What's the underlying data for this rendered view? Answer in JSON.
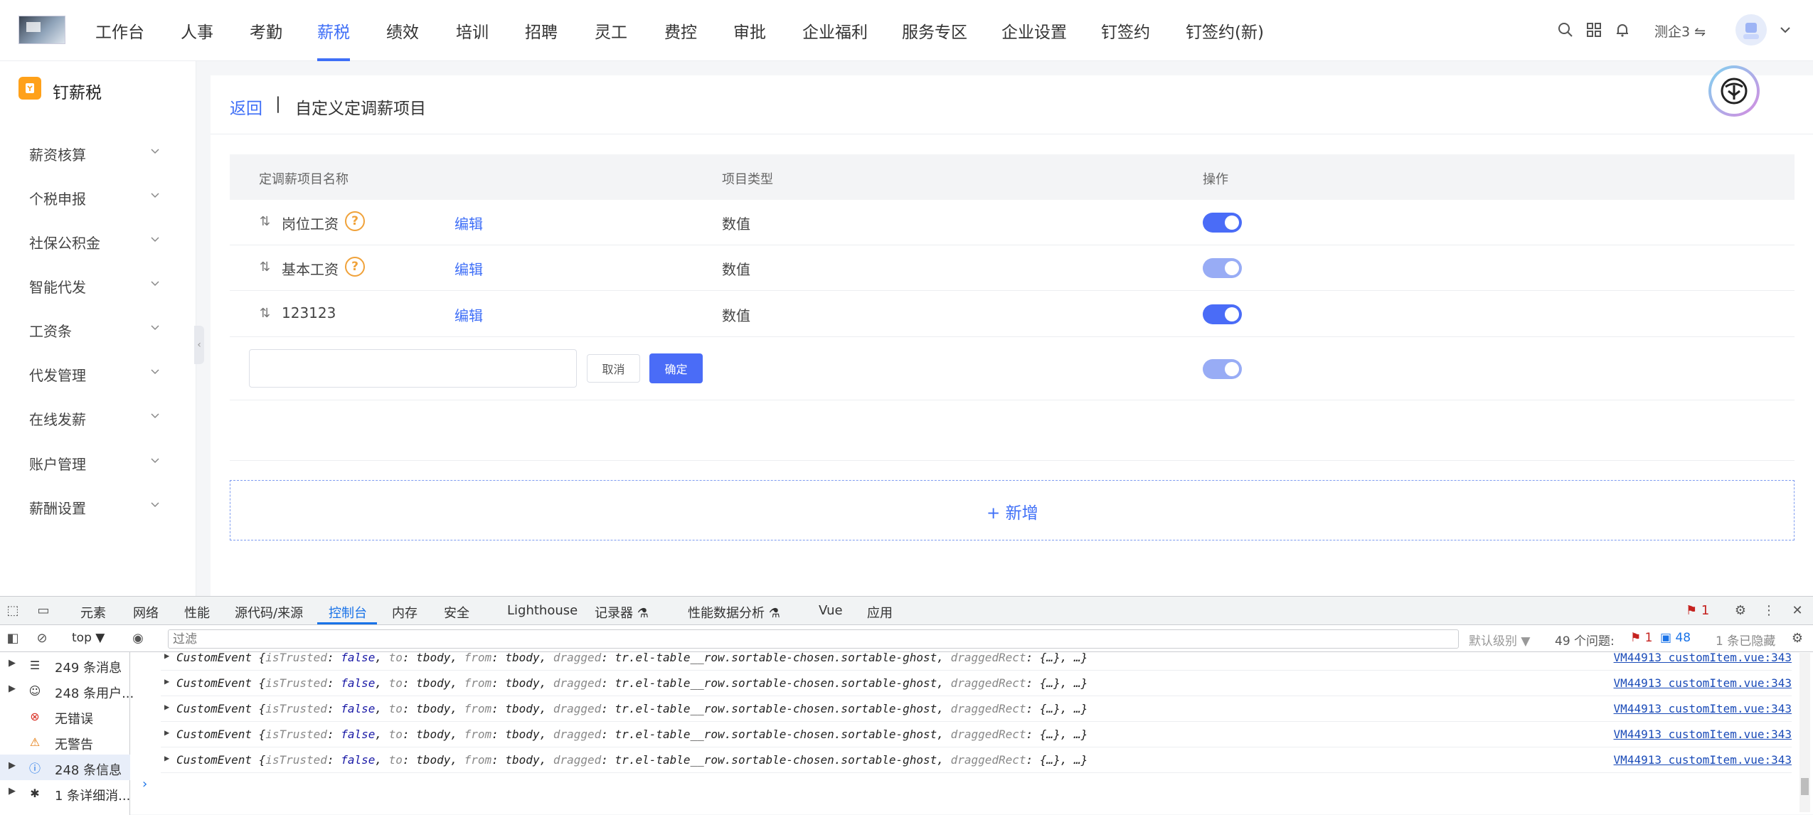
{
  "topnav": {
    "items": [
      "工作台",
      "人事",
      "考勤",
      "薪税",
      "绩效",
      "培训",
      "招聘",
      "灵工",
      "费控",
      "审批",
      "企业福利",
      "服务专区",
      "企业设置",
      "钉签约",
      "钉签约(新)"
    ],
    "active": "薪税",
    "user_name": "测企3",
    "switch_glyph": "⇋",
    "icons": [
      "search-icon",
      "apps-grid-icon",
      "bell-icon",
      "switch-org-icon",
      "user-avatar-icon",
      "chevron-down-icon"
    ]
  },
  "sidebar": {
    "title": "钉薪税",
    "items": [
      "薪资核算",
      "个税申报",
      "社保公积金",
      "智能代发",
      "工资条",
      "代发管理",
      "在线发薪",
      "账户管理",
      "薪酬设置"
    ],
    "collapse_glyph": "‹"
  },
  "page": {
    "back_label": "返回",
    "separator": "|",
    "title": "自定义定调薪项目"
  },
  "table": {
    "headers": [
      "定调薪项目名称",
      "项目类型",
      "操作"
    ],
    "rows": [
      {
        "name": "岗位工资",
        "has_help": true,
        "edit": "编辑",
        "type": "数值",
        "switch_on": true,
        "switch_disabled": false
      },
      {
        "name": "基本工资",
        "has_help": true,
        "edit": "编辑",
        "type": "数值",
        "switch_on": true,
        "switch_disabled": true
      },
      {
        "name": "123123",
        "has_help": false,
        "edit": "编辑",
        "type": "数值",
        "switch_on": true,
        "switch_disabled": false
      }
    ],
    "help_glyph": "?",
    "drag_glyph": "⇅",
    "new_row": {
      "input_value": "",
      "cancel": "取消",
      "confirm": "确定",
      "switch_on": true,
      "switch_disabled": true
    }
  },
  "add_button": {
    "label": "+ 新增"
  },
  "devtools": {
    "tabs": [
      "元素",
      "网络",
      "性能",
      "源代码/来源",
      "控制台",
      "内存",
      "安全",
      "Lighthouse",
      "记录器 ⚗",
      "性能数据分析 ⚗",
      "Vue",
      "应用"
    ],
    "active_tab": "控制台",
    "issue_badge": "1",
    "toolbar": {
      "context": "top ▼",
      "filter_placeholder": "过滤",
      "level": "默认级别 ▼",
      "issues_label": "49 个问题:",
      "issues_errors": "1",
      "issues_info": "48",
      "hidden": "1 条已隐藏"
    },
    "sidebar": [
      {
        "label": "249 条消息",
        "icon": "list-icon",
        "expandable": true
      },
      {
        "label": "248 条用户...",
        "icon": "user-circle-icon",
        "expandable": true
      },
      {
        "label": "无错误",
        "icon": "error-icon",
        "expandable": false
      },
      {
        "label": "无警告",
        "icon": "warning-icon",
        "expandable": false
      },
      {
        "label": "248 条信息",
        "icon": "info-icon",
        "expandable": true,
        "selected": true
      },
      {
        "label": "1 条详细消...",
        "icon": "bug-icon",
        "expandable": true
      }
    ],
    "logs": [
      {
        "prefix": "CustomEvent {",
        "isTrusted": "false",
        "to": "tbody",
        "from": "tbody",
        "dragged": "tr.el-table__row.sortable-chosen.sortable-ghost",
        "draggedRect": "{…}",
        "tail": ", …}",
        "source": "VM44913 customItem.vue:343"
      },
      {
        "prefix": "CustomEvent {",
        "isTrusted": "false",
        "to": "tbody",
        "from": "tbody",
        "dragged": "tr.el-table__row.sortable-chosen.sortable-ghost",
        "draggedRect": "{…}",
        "tail": ", …}",
        "source": "VM44913 customItem.vue:343"
      },
      {
        "prefix": "CustomEvent {",
        "isTrusted": "false",
        "to": "tbody",
        "from": "tbody",
        "dragged": "tr.el-table__row.sortable-chosen.sortable-ghost",
        "draggedRect": "{…}",
        "tail": ", …}",
        "source": "VM44913 customItem.vue:343"
      },
      {
        "prefix": "CustomEvent {",
        "isTrusted": "false",
        "to": "tbody",
        "from": "tbody",
        "dragged": "tr.el-table__row.sortable-chosen.sortable-ghost",
        "draggedRect": "{…}",
        "tail": ", …}",
        "source": "VM44913 customItem.vue:343"
      },
      {
        "prefix": "CustomEvent {",
        "isTrusted": "false",
        "to": "tbody",
        "from": "tbody",
        "dragged": "tr.el-table__row.sortable-chosen.sortable-ghost",
        "draggedRect": "{…}",
        "tail": ", …}",
        "source": "VM44913 customItem.vue:343"
      }
    ],
    "prompt_glyph": "›"
  },
  "colors": {
    "accent": "#3f6ff7",
    "switch_on": "#4a6cf7",
    "switch_disabled": "#98acf5",
    "help": "#f0a23a",
    "devtools_link": "#1a73e8"
  }
}
